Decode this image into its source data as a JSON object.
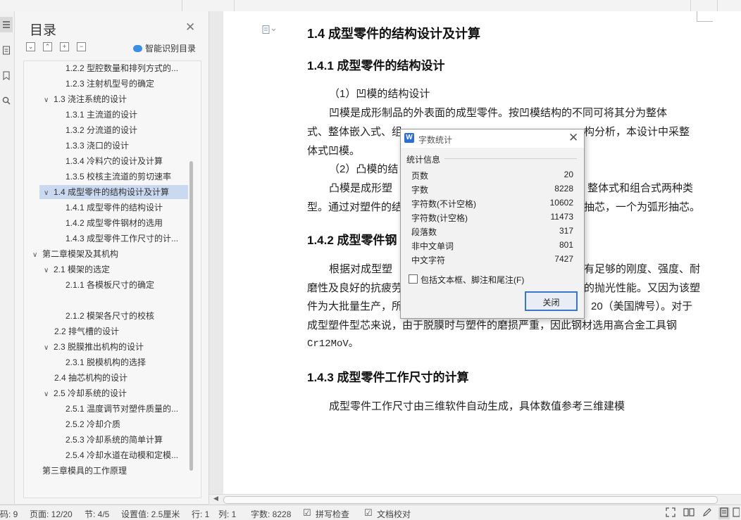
{
  "toc": {
    "title": "目录",
    "smart_label": "智能识别目录",
    "items": [
      {
        "label": "1.2.2 型腔数量和排列方式的..."
      },
      {
        "label": "1.2.3 注射机型号的确定"
      },
      {
        "label": "1.3 浇注系统的设计"
      },
      {
        "label": "1.3.1 主流道的设计"
      },
      {
        "label": "1.3.2 分流道的设计"
      },
      {
        "label": "1.3.3 浇口的设计"
      },
      {
        "label": "1.3.4 冷料穴的设计及计算"
      },
      {
        "label": "1.3.5 校核主流道的剪切速率"
      },
      {
        "label": "1.4 成型零件的结构设计及计算"
      },
      {
        "label": "1.4.1 成型零件的结构设计"
      },
      {
        "label": "1.4.2 成型零件钢材的选用"
      },
      {
        "label": "1.4.3 成型零件工作尺寸的计..."
      },
      {
        "label": "第二章模架及其机构"
      },
      {
        "label": "2.1 模架的选定"
      },
      {
        "label": "2.1.1 各模板尺寸的确定"
      },
      {
        "label": "2.1.2 模架各尺寸的校核"
      },
      {
        "label": "2.2 排气槽的设计"
      },
      {
        "label": "2.3 脱膜推出机构的设计"
      },
      {
        "label": "2.3.1 脱模机构的选择"
      },
      {
        "label": "2.4 抽芯机构的设计"
      },
      {
        "label": "2.5 冷却系统的设计"
      },
      {
        "label": "2.5.1 温度调节对塑件质量的..."
      },
      {
        "label": "2.5.2 冷却介质"
      },
      {
        "label": "2.5.3 冷却系统的简单计算"
      },
      {
        "label": "2.5.4 冷却水道在动模和定模..."
      },
      {
        "label": "第三章模具的工作原理"
      }
    ]
  },
  "doc": {
    "h_1_4": "1.4 成型零件的结构设计及计算",
    "h_1_4_1": "1.4.1 成型零件的结构设计",
    "p1": "（1）凹模的结构设计",
    "p2": "凹模是成形制品的外表面的成型零件。按凹模结构的不同可将其分为整体",
    "p3a": "式、整体嵌入式、组",
    "p3b": "构分析，本设计中采整",
    "p4": "体式凹模。",
    "p5": "（2）凸模的结",
    "p6a": "凸模是成形塑",
    "p6b": "整体式和组合式两种类",
    "p7a": "型。通过对塑件的结",
    "p7b": "抽芯，一个为弧形抽芯。",
    "h_1_4_2": "1.4.2 成型零件钢",
    "p8a": "根据对成型塑",
    "p8b": "有足够的刚度、强度、耐",
    "p9a": "磨性及良好的抗疲劳",
    "p9b": "的抛光性能。又因为该塑",
    "p10a": "件为大批量生产，所",
    "p10b": "20（美国牌号）。对于",
    "p11": "成型塑件型芯来说，由于脱膜时与塑件的磨损严重，因此钢材选用高合金工具钢",
    "p12": "Cr12MoV。",
    "h_1_4_3": "1.4.3 成型零件工作尺寸的计算",
    "p13": "成型零件工作尺寸由三维软件自动生成，具体数值参考三维建模"
  },
  "dialog": {
    "title": "字数统计",
    "group_label": "统计信息",
    "rows": [
      {
        "k": "页数",
        "v": "20"
      },
      {
        "k": "字数",
        "v": "8228"
      },
      {
        "k": "字符数(不计空格)",
        "v": "10602"
      },
      {
        "k": "字符数(计空格)",
        "v": "11473"
      },
      {
        "k": "段落数",
        "v": "317"
      },
      {
        "k": "非中文单词",
        "v": "801"
      },
      {
        "k": "中文字符",
        "v": "7427"
      }
    ],
    "checkbox_label": "包括文本框、脚注和尾注(F)",
    "close_label": "关闭"
  },
  "status": {
    "code": "码: 9",
    "page": "页面: 12/20",
    "section": "节: 4/5",
    "setting": "设置值: 2.5厘米",
    "row": "行: 1",
    "col": "列: 1",
    "words": "字数: 8228",
    "spell": "拼写检查",
    "proof": "文档校对"
  },
  "icons": [
    "list-icon",
    "document-icon",
    "bookmark-icon",
    "search-icon",
    "page-icon",
    "fullscreen-icon",
    "book-icon",
    "pen-icon",
    "page-view-icon",
    "page-view-alt-icon"
  ],
  "colors": {
    "accent": "#2b6fd6",
    "selection": "#c9d9ef"
  }
}
